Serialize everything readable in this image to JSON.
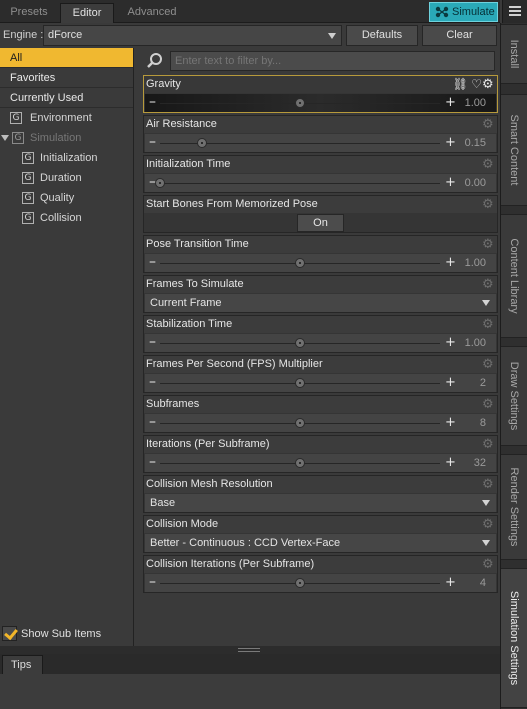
{
  "tabs": [
    {
      "label": "Presets",
      "active": false
    },
    {
      "label": "Editor",
      "active": true
    },
    {
      "label": "Advanced",
      "active": false
    }
  ],
  "simulate_label": "Simulate",
  "engine": {
    "label": "Engine :",
    "value": "dForce",
    "defaults_label": "Defaults",
    "clear_label": "Clear"
  },
  "sidebar": {
    "categories": [
      "All",
      "Favorites",
      "Currently Used"
    ],
    "tree": [
      "Environment",
      "Simulation",
      "Initialization",
      "Duration",
      "Quality",
      "Collision"
    ],
    "show_sub_items": "Show Sub Items"
  },
  "filter": {
    "placeholder": "Enter text to filter by..."
  },
  "properties": [
    {
      "label": "Gravity",
      "type": "slider",
      "value": "1.00",
      "level": 0.5
    },
    {
      "label": "Air Resistance",
      "type": "slider",
      "value": "0.15",
      "level": 0.15
    },
    {
      "label": "Initialization Time",
      "type": "slider",
      "value": "0.00",
      "level": 0.0
    },
    {
      "label": "Start Bones From Memorized Pose",
      "type": "toggle",
      "value": "On"
    },
    {
      "label": "Pose Transition Time",
      "type": "slider",
      "value": "1.00",
      "level": 0.5
    },
    {
      "label": "Frames To Simulate",
      "type": "dropdown",
      "value": "Current Frame"
    },
    {
      "label": "Stabilization Time",
      "type": "slider",
      "value": "1.00",
      "level": 0.5
    },
    {
      "label": "Frames Per Second (FPS) Multiplier",
      "type": "slider",
      "value": "2",
      "level": 0.5
    },
    {
      "label": "Subframes",
      "type": "slider",
      "value": "8",
      "level": 0.5
    },
    {
      "label": "Iterations (Per Subframe)",
      "type": "slider",
      "value": "32",
      "level": 0.5
    },
    {
      "label": "Collision Mesh Resolution",
      "type": "dropdown",
      "value": "Base"
    },
    {
      "label": "Collision Mode",
      "type": "dropdown",
      "value": "Better - Continuous : CCD Vertex-Face"
    },
    {
      "label": "Collision Iterations (Per Subframe)",
      "type": "slider",
      "value": "4",
      "level": 0.5
    }
  ],
  "side_tabs": [
    "Install",
    "Smart Content",
    "Content Library",
    "Draw Settings",
    "Render Settings",
    "Simulation Settings"
  ],
  "tips_label": "Tips",
  "colors": {
    "accent": "#f0b830",
    "simulate": "#2aa9b8"
  }
}
